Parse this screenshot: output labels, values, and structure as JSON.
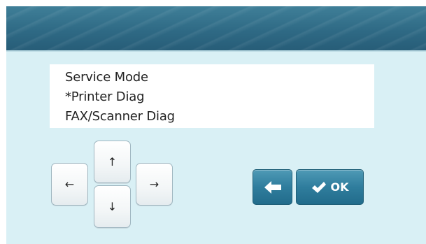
{
  "menu": {
    "items": [
      {
        "label": "Service Mode"
      },
      {
        "label": "*Printer Diag"
      },
      {
        "label": "FAX/Scanner Diag"
      }
    ]
  },
  "arrows": {
    "up": "↑",
    "down": "↓",
    "left": "←",
    "right": "→"
  },
  "buttons": {
    "back_icon": "back-arrow-icon",
    "ok_icon": "checkmark-icon",
    "ok_label": "OK"
  },
  "colors": {
    "header": "#2f6a85",
    "background": "#d9f0f5",
    "accent_button": "#2f7d9d"
  }
}
